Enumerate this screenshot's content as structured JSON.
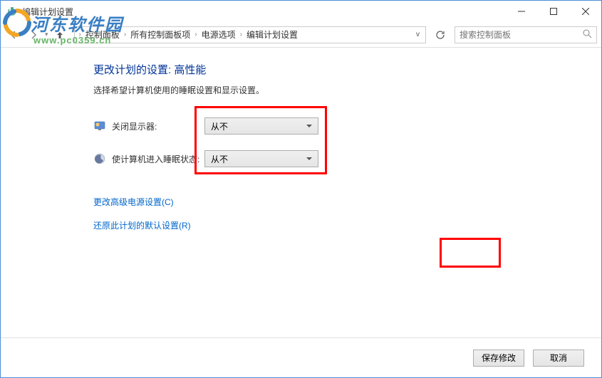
{
  "titlebar": {
    "title": "编辑计划设置"
  },
  "breadcrumb": {
    "items": [
      "控制面板",
      "所有控制面板项",
      "电源选项",
      "编辑计划设置"
    ]
  },
  "search": {
    "placeholder": "搜索控制面板"
  },
  "content": {
    "heading": "更改计划的设置: 高性能",
    "subheading": "选择希望计算机使用的睡眠设置和显示设置。",
    "settings": [
      {
        "label": "关闭显示器:",
        "value": "从不"
      },
      {
        "label": "使计算机进入睡眠状态:",
        "value": "从不"
      }
    ],
    "links": [
      "更改高级电源设置(C)",
      "还原此计划的默认设置(R)"
    ]
  },
  "footer": {
    "save": "保存修改",
    "cancel": "取消"
  },
  "watermark": {
    "text": "河东软件园",
    "url": "www.pc0359.cn"
  }
}
